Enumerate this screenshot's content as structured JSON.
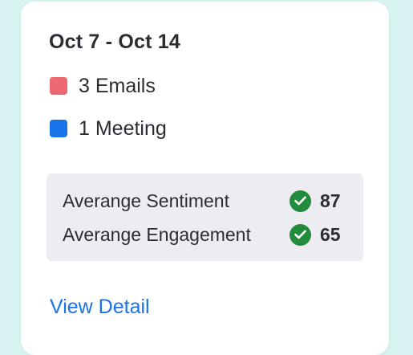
{
  "card": {
    "date_range": "Oct 7 - Oct 14",
    "legend": [
      {
        "label": "3 Emails",
        "color": "#ee6873"
      },
      {
        "label": "1 Meeting",
        "color": "#1973e8"
      }
    ],
    "metrics": [
      {
        "label": "Averange Sentiment",
        "value": "87",
        "icon": "check-circle-icon"
      },
      {
        "label": "Averange Engagement",
        "value": "65",
        "icon": "check-circle-icon"
      }
    ],
    "link_label": "View Detail"
  },
  "colors": {
    "background": "#d7f4f2",
    "card": "#ffffff",
    "metrics_panel": "#ececf1",
    "check": "#238c3c",
    "link": "#1a73e8"
  }
}
